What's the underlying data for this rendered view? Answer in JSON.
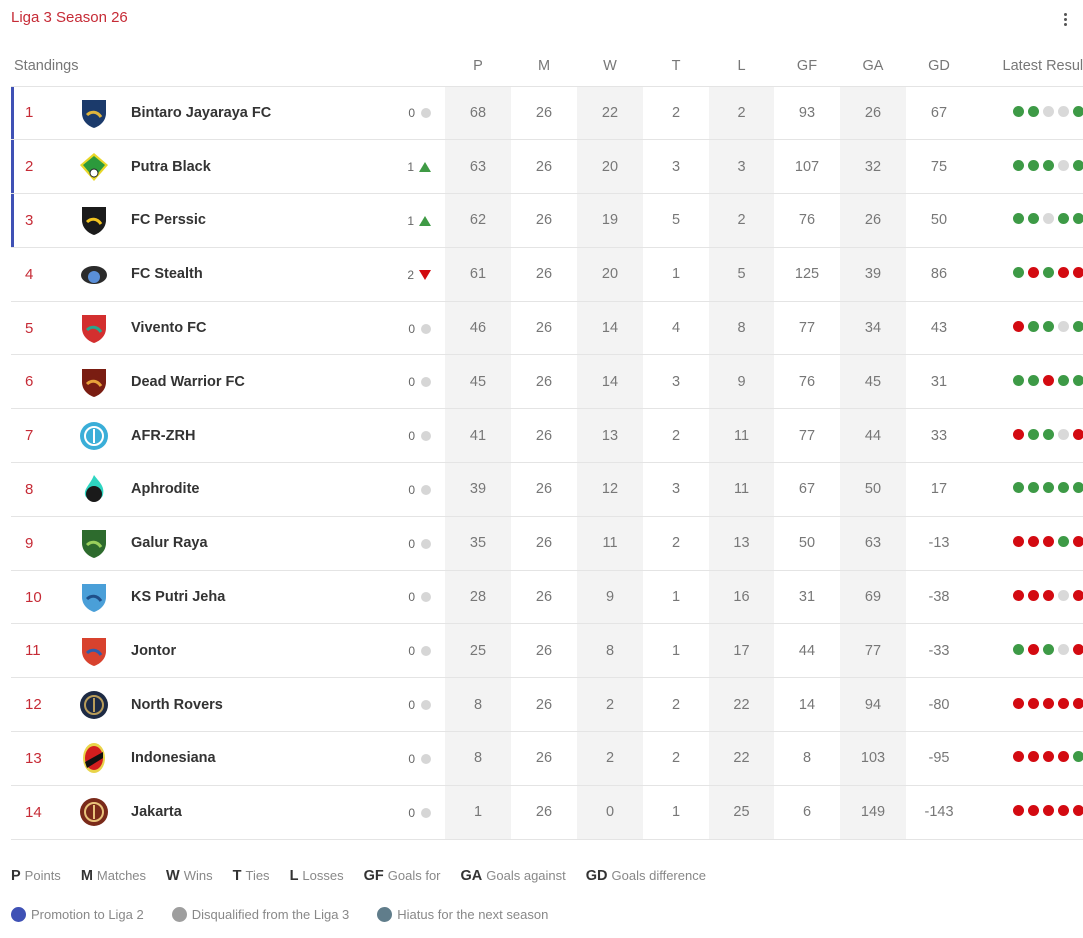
{
  "header": {
    "title": "Liga 3 Season 26",
    "menu_icon": "more-vertical-icon"
  },
  "table": {
    "columns": [
      "Standings",
      "P",
      "M",
      "W",
      "T",
      "L",
      "GF",
      "GA",
      "GD",
      "Latest Results"
    ],
    "rows": [
      {
        "rank": "1",
        "team": "Bintaro Jayaraya FC",
        "change": "0",
        "trend": "same",
        "promo": true,
        "P": "68",
        "M": "26",
        "W": "22",
        "T": "2",
        "L": "2",
        "GF": "93",
        "GA": "26",
        "GD": "67",
        "results": [
          "W",
          "W",
          "D",
          "D",
          "W"
        ]
      },
      {
        "rank": "2",
        "team": "Putra Black",
        "change": "1",
        "trend": "up",
        "promo": true,
        "P": "63",
        "M": "26",
        "W": "20",
        "T": "3",
        "L": "3",
        "GF": "107",
        "GA": "32",
        "GD": "75",
        "results": [
          "W",
          "W",
          "W",
          "D",
          "W"
        ]
      },
      {
        "rank": "3",
        "team": "FC Perssic",
        "change": "1",
        "trend": "up",
        "promo": true,
        "P": "62",
        "M": "26",
        "W": "19",
        "T": "5",
        "L": "2",
        "GF": "76",
        "GA": "26",
        "GD": "50",
        "results": [
          "W",
          "W",
          "D",
          "W",
          "W"
        ]
      },
      {
        "rank": "4",
        "team": "FC Stealth",
        "change": "2",
        "trend": "down",
        "promo": false,
        "P": "61",
        "M": "26",
        "W": "20",
        "T": "1",
        "L": "5",
        "GF": "125",
        "GA": "39",
        "GD": "86",
        "results": [
          "W",
          "L",
          "W",
          "L",
          "L"
        ]
      },
      {
        "rank": "5",
        "team": "Vivento FC",
        "change": "0",
        "trend": "same",
        "promo": false,
        "P": "46",
        "M": "26",
        "W": "14",
        "T": "4",
        "L": "8",
        "GF": "77",
        "GA": "34",
        "GD": "43",
        "results": [
          "L",
          "W",
          "W",
          "D",
          "W"
        ]
      },
      {
        "rank": "6",
        "team": "Dead Warrior FC",
        "change": "0",
        "trend": "same",
        "promo": false,
        "P": "45",
        "M": "26",
        "W": "14",
        "T": "3",
        "L": "9",
        "GF": "76",
        "GA": "45",
        "GD": "31",
        "results": [
          "W",
          "W",
          "L",
          "W",
          "W"
        ]
      },
      {
        "rank": "7",
        "team": "AFR-ZRH",
        "change": "0",
        "trend": "same",
        "promo": false,
        "P": "41",
        "M": "26",
        "W": "13",
        "T": "2",
        "L": "11",
        "GF": "77",
        "GA": "44",
        "GD": "33",
        "results": [
          "L",
          "W",
          "W",
          "D",
          "L"
        ]
      },
      {
        "rank": "8",
        "team": "Aphrodite",
        "change": "0",
        "trend": "same",
        "promo": false,
        "P": "39",
        "M": "26",
        "W": "12",
        "T": "3",
        "L": "11",
        "GF": "67",
        "GA": "50",
        "GD": "17",
        "results": [
          "W",
          "W",
          "W",
          "W",
          "W"
        ]
      },
      {
        "rank": "9",
        "team": "Galur Raya",
        "change": "0",
        "trend": "same",
        "promo": false,
        "P": "35",
        "M": "26",
        "W": "11",
        "T": "2",
        "L": "13",
        "GF": "50",
        "GA": "63",
        "GD": "-13",
        "results": [
          "L",
          "L",
          "L",
          "W",
          "L"
        ]
      },
      {
        "rank": "10",
        "team": "KS Putri Jeha",
        "change": "0",
        "trend": "same",
        "promo": false,
        "P": "28",
        "M": "26",
        "W": "9",
        "T": "1",
        "L": "16",
        "GF": "31",
        "GA": "69",
        "GD": "-38",
        "results": [
          "L",
          "L",
          "L",
          "D",
          "L"
        ]
      },
      {
        "rank": "11",
        "team": "Jontor",
        "change": "0",
        "trend": "same",
        "promo": false,
        "P": "25",
        "M": "26",
        "W": "8",
        "T": "1",
        "L": "17",
        "GF": "44",
        "GA": "77",
        "GD": "-33",
        "results": [
          "W",
          "L",
          "W",
          "D",
          "L"
        ]
      },
      {
        "rank": "12",
        "team": "North Rovers",
        "change": "0",
        "trend": "same",
        "promo": false,
        "P": "8",
        "M": "26",
        "W": "2",
        "T": "2",
        "L": "22",
        "GF": "14",
        "GA": "94",
        "GD": "-80",
        "results": [
          "L",
          "L",
          "L",
          "L",
          "L"
        ]
      },
      {
        "rank": "13",
        "team": "Indonesiana",
        "change": "0",
        "trend": "same",
        "promo": false,
        "P": "8",
        "M": "26",
        "W": "2",
        "T": "2",
        "L": "22",
        "GF": "8",
        "GA": "103",
        "GD": "-95",
        "results": [
          "L",
          "L",
          "L",
          "L",
          "W"
        ]
      },
      {
        "rank": "14",
        "team": "Jakarta",
        "change": "0",
        "trend": "same",
        "promo": false,
        "P": "1",
        "M": "26",
        "W": "0",
        "T": "1",
        "L": "25",
        "GF": "6",
        "GA": "149",
        "GD": "-143",
        "results": [
          "L",
          "L",
          "L",
          "L",
          "L"
        ]
      }
    ]
  },
  "abbreviations": [
    {
      "key": "P",
      "label": "Points"
    },
    {
      "key": "M",
      "label": "Matches"
    },
    {
      "key": "W",
      "label": "Wins"
    },
    {
      "key": "T",
      "label": "Ties"
    },
    {
      "key": "L",
      "label": "Losses"
    },
    {
      "key": "GF",
      "label": "Goals for"
    },
    {
      "key": "GA",
      "label": "Goals against"
    },
    {
      "key": "GD",
      "label": "Goals difference"
    }
  ],
  "legend": [
    {
      "label": "Promotion to Liga 2",
      "color": "#3f51b5"
    },
    {
      "label": "Disqualified from the Liga 3",
      "color": "#9e9e9e"
    },
    {
      "label": "Hiatus for the next season",
      "color": "#607d8b"
    }
  ],
  "colors": {
    "accent": "#c62b36",
    "win": "#3d9a46",
    "loss": "#d30a11",
    "draw": "#d9d9d9",
    "trend_up": "#3f9a45",
    "trend_down": "#d10a10"
  },
  "crests": [
    {
      "team": "Bintaro Jayaraya FC",
      "primary": "#1b3a6b",
      "secondary": "#e0b53c",
      "shape": "shield"
    },
    {
      "team": "Putra Black",
      "primary": "#2c9a3c",
      "secondary": "#e9d728",
      "shape": "diamond"
    },
    {
      "team": "FC Perssic",
      "primary": "#1b1b1b",
      "secondary": "#f2c420",
      "shape": "shield"
    },
    {
      "team": "FC Stealth",
      "primary": "#2b2b2b",
      "secondary": "#5a8fd8",
      "shape": "round"
    },
    {
      "team": "Vivento FC",
      "primary": "#d32f2f",
      "secondary": "#2aa58c",
      "shape": "shield"
    },
    {
      "team": "Dead Warrior FC",
      "primary": "#7a1d12",
      "secondary": "#e8a23a",
      "shape": "shield"
    },
    {
      "team": "AFR-ZRH",
      "primary": "#3aaed8",
      "secondary": "#ffffff",
      "shape": "circle"
    },
    {
      "team": "Aphrodite",
      "primary": "#1a1a1a",
      "secondary": "#2fd6c2",
      "shape": "flame"
    },
    {
      "team": "Galur Raya",
      "primary": "#2d6b2d",
      "secondary": "#9ad05c",
      "shape": "shield"
    },
    {
      "team": "KS Putri Jeha",
      "primary": "#4a9fd8",
      "secondary": "#1f4f8a",
      "shape": "shield"
    },
    {
      "team": "Jontor",
      "primary": "#d8422e",
      "secondary": "#2d5dac",
      "shape": "shield"
    },
    {
      "team": "North Rovers",
      "primary": "#1d2a44",
      "secondary": "#b89c5a",
      "shape": "circle"
    },
    {
      "team": "Indonesiana",
      "primary": "#d21e1e",
      "secondary": "#111111",
      "shape": "oval"
    },
    {
      "team": "Jakarta",
      "primary": "#7a2a1a",
      "secondary": "#e8c27a",
      "shape": "circle"
    }
  ]
}
